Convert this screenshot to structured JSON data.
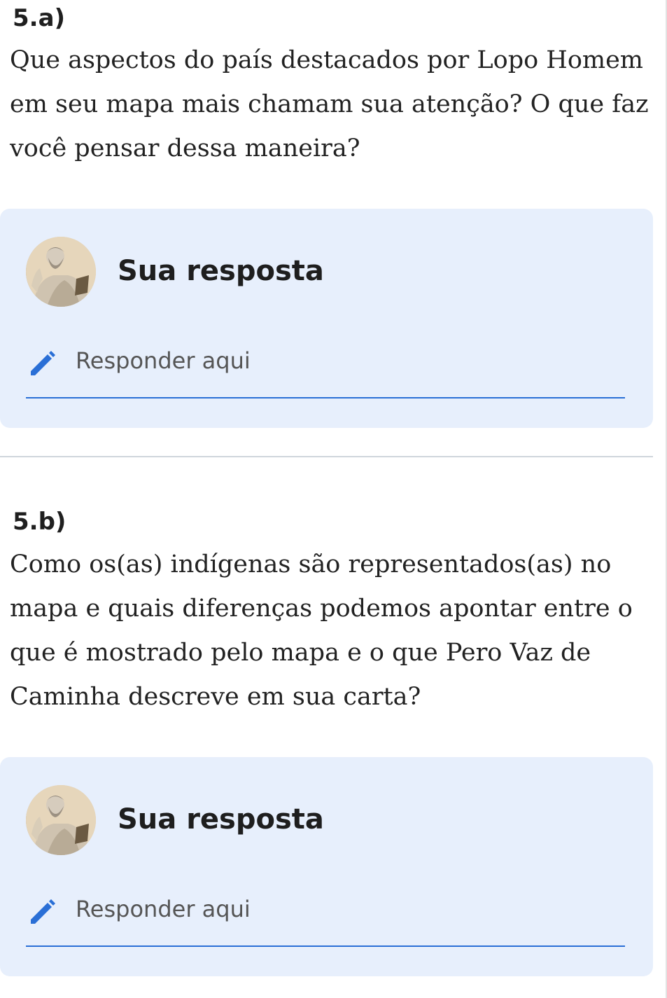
{
  "questions": [
    {
      "label": "5.a)",
      "text": "Que aspectos do país destacados por Lopo Homem em seu mapa mais chamam sua atenção? O que faz você pensar dessa maneira?",
      "answer": {
        "title": "Sua resposta",
        "placeholder": "Responder aqui"
      }
    },
    {
      "label": "5.b)",
      "text": "Como os(as) indígenas são representados(as) no mapa e quais diferenças podemos apontar entre o que é mostrado pelo mapa e o que Pero Vaz de Caminha descreve em sua carta?",
      "answer": {
        "title": "Sua resposta",
        "placeholder": "Responder aqui"
      }
    }
  ],
  "colors": {
    "card_background": "#e7effc",
    "accent_blue": "#2a6fd6",
    "divider": "#cfd6dc"
  },
  "icons": {
    "edit": "pencil-icon",
    "avatar": "philosopher-statue-avatar"
  }
}
